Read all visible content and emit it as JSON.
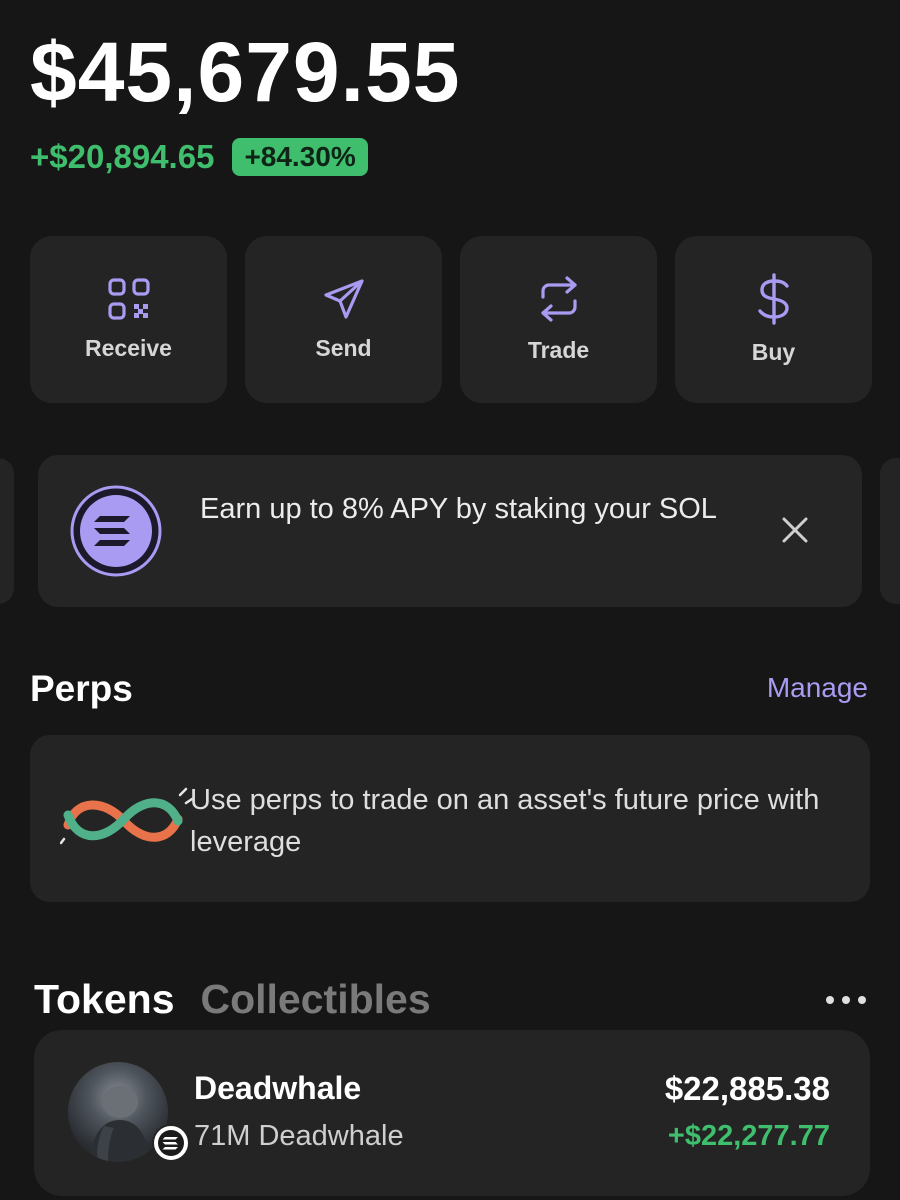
{
  "portfolio": {
    "balance": "$45,679.55",
    "change_amount": "+$20,894.65",
    "change_percent": "+84.30%"
  },
  "actions": [
    {
      "label": "Receive",
      "icon": "qr-code-icon"
    },
    {
      "label": "Send",
      "icon": "send-icon"
    },
    {
      "label": "Trade",
      "icon": "swap-icon"
    },
    {
      "label": "Buy",
      "icon": "dollar-icon"
    }
  ],
  "banner": {
    "text": "Earn up to 8% APY by staking your SOL",
    "icon": "solana-logo-icon",
    "close_icon": "close-icon"
  },
  "perps": {
    "title": "Perps",
    "manage_label": "Manage",
    "description": "Use perps to trade on an asset's future price with leverage"
  },
  "tabs": {
    "tokens": "Tokens",
    "collectibles": "Collectibles",
    "more_icon": "more-icon"
  },
  "tokens": [
    {
      "name": "Deadwhale",
      "amount": "71M Deadwhale",
      "value": "$22,885.38",
      "change": "+$22,277.77"
    }
  ],
  "colors": {
    "background": "#161616",
    "card": "#242424",
    "positive": "#3fbf6d",
    "accent": "#a99bf2"
  }
}
